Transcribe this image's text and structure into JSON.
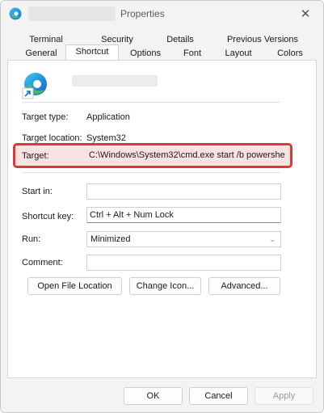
{
  "window": {
    "title": "Properties",
    "close_glyph": "✕"
  },
  "tabs_row1": [
    {
      "label": "Terminal"
    },
    {
      "label": "Security"
    },
    {
      "label": "Details"
    },
    {
      "label": "Previous Versions"
    }
  ],
  "tabs_row2": [
    {
      "label": "General"
    },
    {
      "label": "Shortcut",
      "active": true
    },
    {
      "label": "Options"
    },
    {
      "label": "Font"
    },
    {
      "label": "Layout"
    },
    {
      "label": "Colors"
    }
  ],
  "shortcut": {
    "target_type_label": "Target type:",
    "target_type_value": "Application",
    "target_location_label": "Target location:",
    "target_location_value": "System32",
    "target_label": "Target:",
    "target_value": "C:\\Windows\\System32\\cmd.exe start /b powershe",
    "start_in_label": "Start in:",
    "start_in_value": "",
    "shortcut_key_label": "Shortcut key:",
    "shortcut_key_value": "Ctrl + Alt + Num Lock",
    "run_label": "Run:",
    "run_value": "Minimized",
    "comment_label": "Comment:",
    "comment_value": ""
  },
  "actions": {
    "open_file_location": "Open File Location",
    "change_icon": "Change Icon...",
    "advanced": "Advanced..."
  },
  "footer": {
    "ok": "OK",
    "cancel": "Cancel",
    "apply": "Apply"
  },
  "colors": {
    "highlight_border": "#d9393a",
    "accent": "#1f7ad6"
  },
  "icons": {
    "app": "edge-icon",
    "shortcut_overlay": "shortcut-arrow-icon"
  }
}
